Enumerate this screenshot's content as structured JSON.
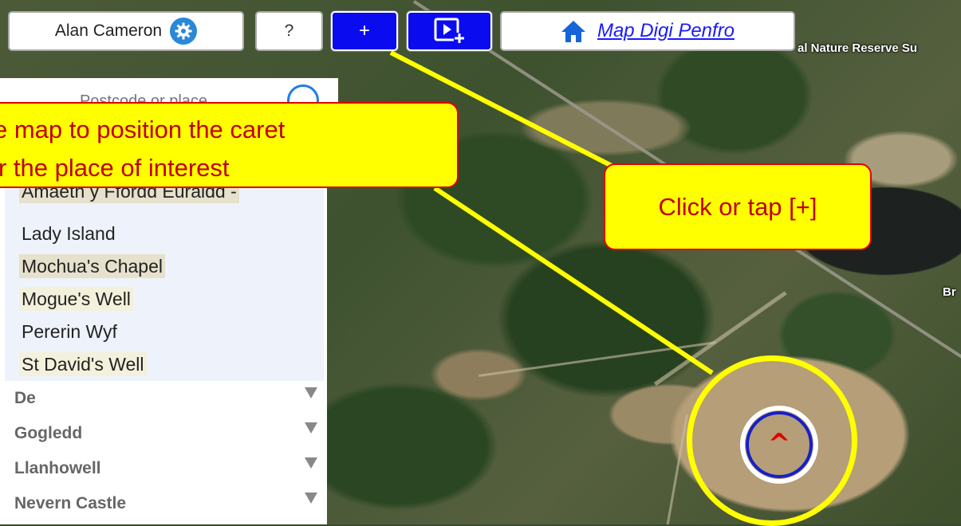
{
  "map": {
    "labels": [
      "al Nature Reserve Su",
      "Br"
    ]
  },
  "toolbar": {
    "user_name": "Alan Cameron",
    "help_label": "?",
    "add_label": "+",
    "home_link": "Map Digi Penfro"
  },
  "search": {
    "placeholder": "Postcode or place"
  },
  "sidebar": {
    "sites": [
      "Amaeth y Ffordd Euraidd -",
      "Lady Island",
      "Mochua's Chapel",
      "Mogue's Well",
      "Pererin Wyf",
      "St David's Well"
    ],
    "regions": [
      "De",
      "Gogledd",
      "Llanhowell",
      "Nevern Castle"
    ]
  },
  "callouts": {
    "left_line1": "e map to position the caret",
    "left_line2": "r the place of interest",
    "right": "Click or tap [+]"
  },
  "marker": {
    "caret": "^"
  },
  "colors": {
    "button_blue": "#0b0bf0",
    "callout_fill": "#ffff00",
    "callout_border": "#e00000",
    "callout_text": "#c00000",
    "link": "#1a1aff"
  }
}
